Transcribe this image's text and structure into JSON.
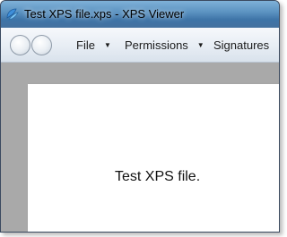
{
  "window": {
    "title": "Test XPS file.xps - XPS Viewer"
  },
  "toolbar": {
    "back_icon": "back-arrow-icon",
    "forward_icon": "forward-arrow-icon",
    "menus": [
      {
        "label": "File",
        "has_dropdown": true
      },
      {
        "label": "Permissions",
        "has_dropdown": true
      },
      {
        "label": "Signatures",
        "has_dropdown": false
      }
    ]
  },
  "document": {
    "text": "Test XPS file."
  }
}
